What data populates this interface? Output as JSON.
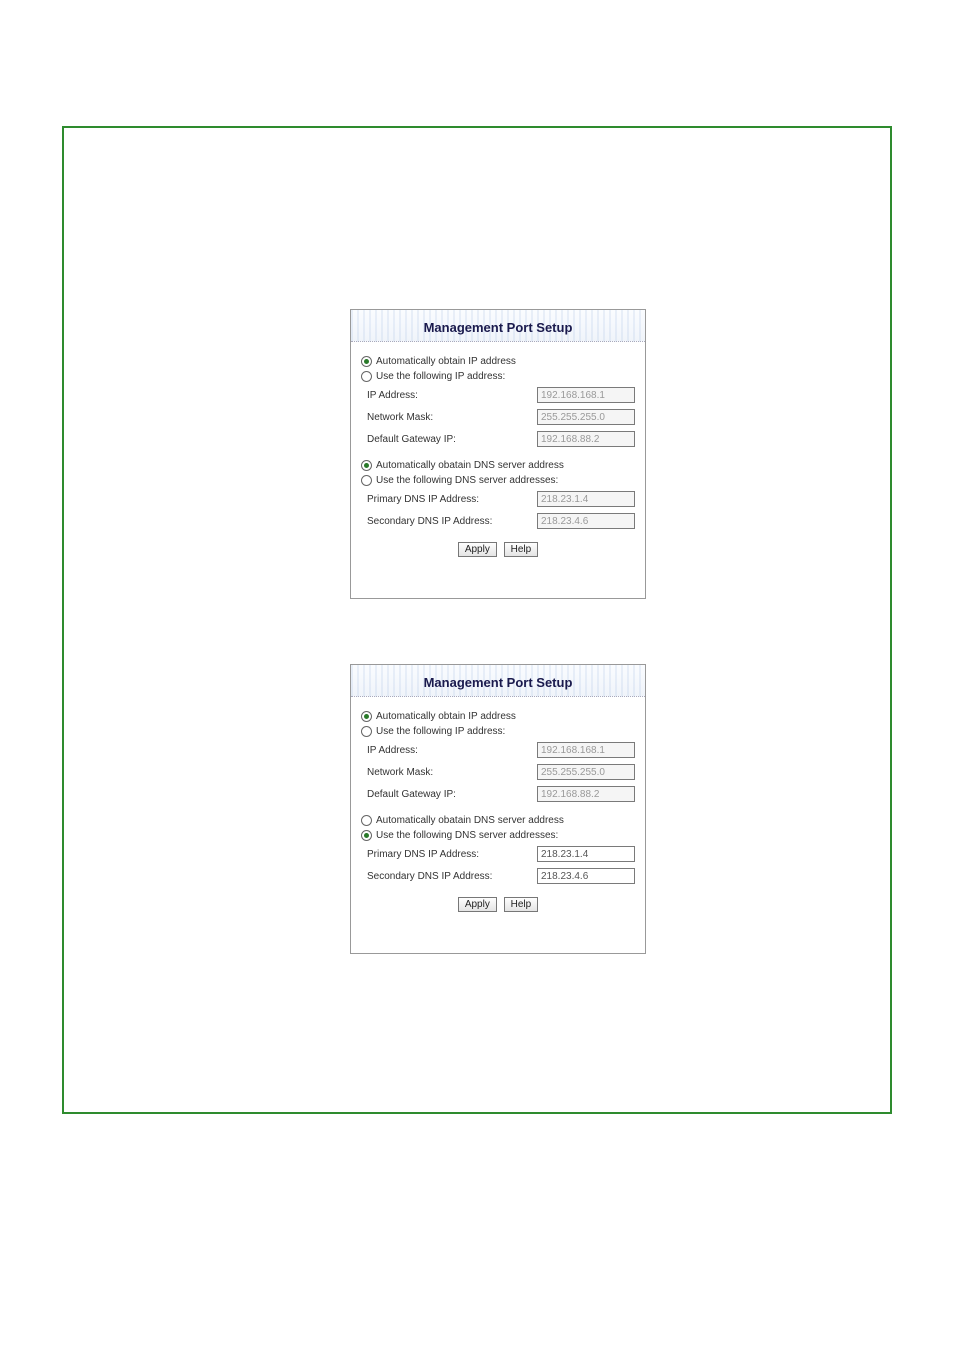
{
  "panel1": {
    "title": "Management Port Setup",
    "ip_auto_label": "Automatically obtain IP address",
    "ip_manual_label": "Use the following IP address:",
    "ip_address_label": "IP Address:",
    "ip_address_value": "192.168.168.1",
    "netmask_label": "Network Mask:",
    "netmask_value": "255.255.255.0",
    "gateway_label": "Default Gateway IP:",
    "gateway_value": "192.168.88.2",
    "dns_auto_label": "Automatically obatain DNS server address",
    "dns_manual_label": "Use the following DNS server addresses:",
    "primary_dns_label": "Primary DNS IP Address:",
    "primary_dns_value": "218.23.1.4",
    "secondary_dns_label": "Secondary DNS IP Address:",
    "secondary_dns_value": "218.23.4.6",
    "apply_label": "Apply",
    "help_label": "Help",
    "ip_mode_selected": "auto",
    "dns_mode_selected": "auto"
  },
  "panel2": {
    "title": "Management Port Setup",
    "ip_auto_label": "Automatically obtain IP address",
    "ip_manual_label": "Use the following IP address:",
    "ip_address_label": "IP Address:",
    "ip_address_value": "192.168.168.1",
    "netmask_label": "Network Mask:",
    "netmask_value": "255.255.255.0",
    "gateway_label": "Default Gateway IP:",
    "gateway_value": "192.168.88.2",
    "dns_auto_label": "Automatically obatain DNS server address",
    "dns_manual_label": "Use the following DNS server addresses:",
    "primary_dns_label": "Primary DNS IP Address:",
    "primary_dns_value": "218.23.1.4",
    "secondary_dns_label": "Secondary DNS IP Address:",
    "secondary_dns_value": "218.23.4.6",
    "apply_label": "Apply",
    "help_label": "Help",
    "ip_mode_selected": "auto",
    "dns_mode_selected": "manual"
  }
}
